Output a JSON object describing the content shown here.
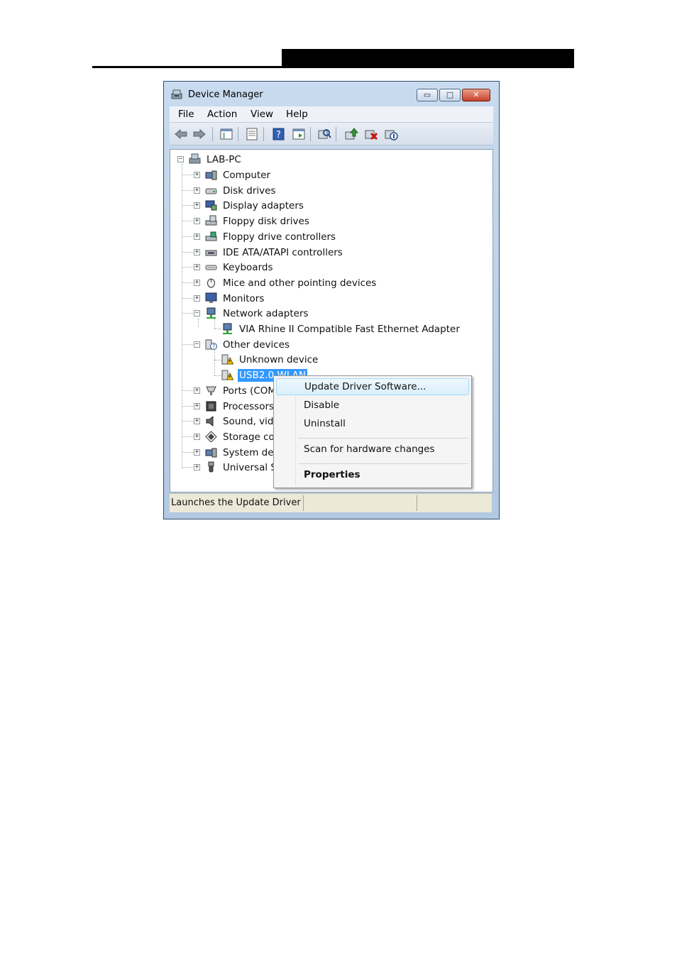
{
  "window": {
    "title": "Device Manager",
    "minimize_glyph": "▭",
    "maximize_glyph": "□",
    "close_glyph": "✕"
  },
  "menubar": [
    "File",
    "Action",
    "View",
    "Help"
  ],
  "toolbar": {
    "icons": [
      "back-arrow-icon",
      "forward-arrow-icon",
      "show-hide-tree-icon",
      "properties-icon",
      "help-icon",
      "action-pane-icon",
      "scan-hardware-icon",
      "update-driver-icon",
      "uninstall-icon",
      "disable-icon"
    ]
  },
  "tree": {
    "root": "LAB-PC",
    "items": [
      {
        "label": "Computer",
        "expander": "+",
        "icon": "computer-icon"
      },
      {
        "label": "Disk drives",
        "expander": "+",
        "icon": "disk-drive-icon"
      },
      {
        "label": "Display adapters",
        "expander": "+",
        "icon": "display-adapter-icon"
      },
      {
        "label": "Floppy disk drives",
        "expander": "+",
        "icon": "floppy-drive-icon"
      },
      {
        "label": "Floppy drive controllers",
        "expander": "+",
        "icon": "floppy-controller-icon"
      },
      {
        "label": "IDE ATA/ATAPI controllers",
        "expander": "+",
        "icon": "ide-controller-icon"
      },
      {
        "label": "Keyboards",
        "expander": "+",
        "icon": "keyboard-icon"
      },
      {
        "label": "Mice and other pointing devices",
        "expander": "+",
        "icon": "mouse-icon"
      },
      {
        "label": "Monitors",
        "expander": "+",
        "icon": "monitor-icon"
      },
      {
        "label": "Network adapters",
        "expander": "−",
        "icon": "network-adapter-icon"
      },
      {
        "label": "VIA Rhine II Compatible Fast Ethernet Adapter",
        "child": true,
        "icon": "network-adapter-icon"
      },
      {
        "label": "Other devices",
        "expander": "−",
        "icon": "unknown-device-icon"
      },
      {
        "label": "Unknown device",
        "child": true,
        "icon": "warning-device-icon"
      },
      {
        "label": "USB2.0 WLAN",
        "child": true,
        "selected": true,
        "icon": "warning-device-icon"
      },
      {
        "label": "Ports (COM",
        "expander": "+",
        "icon": "port-icon"
      },
      {
        "label": "Processors",
        "expander": "+",
        "icon": "processor-icon"
      },
      {
        "label": "Sound, vid",
        "expander": "+",
        "icon": "speaker-icon"
      },
      {
        "label": "Storage co",
        "expander": "+",
        "icon": "storage-controller-icon"
      },
      {
        "label": "System dev",
        "expander": "+",
        "icon": "system-device-icon"
      },
      {
        "label": "Universal S",
        "expander": "+",
        "icon": "usb-icon"
      }
    ]
  },
  "context_menu": {
    "items": [
      {
        "label": "Update Driver Software...",
        "highlighted": true
      },
      {
        "label": "Disable"
      },
      {
        "label": "Uninstall"
      },
      {
        "label": "Scan for hardware changes"
      },
      {
        "label": "Properties",
        "bold": true
      }
    ]
  },
  "statusbar": {
    "text": "Launches the Update Driver S"
  }
}
